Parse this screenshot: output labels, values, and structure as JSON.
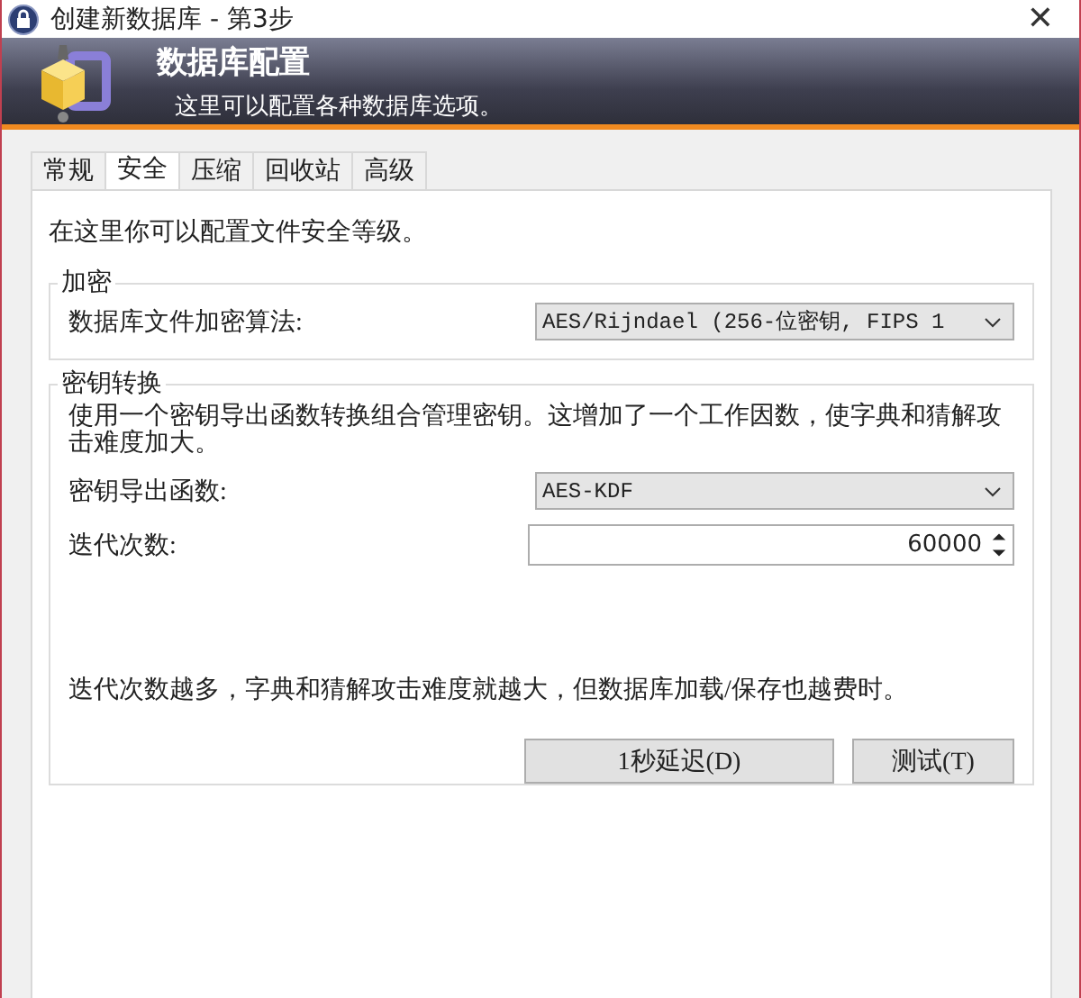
{
  "window": {
    "title": "创建新数据库 - 第3步",
    "close": "✕"
  },
  "banner": {
    "title": "数据库配置",
    "subtitle": "这里可以配置各种数据库选项。"
  },
  "tabs": [
    {
      "label": "常规",
      "selected": false
    },
    {
      "label": "安全",
      "selected": true
    },
    {
      "label": "压缩",
      "selected": false
    },
    {
      "label": "回收站",
      "selected": false
    },
    {
      "label": "高级",
      "selected": false
    }
  ],
  "intro": "在这里你可以配置文件安全等级。",
  "encryption": {
    "title": "加密",
    "label": "数据库文件加密算法:",
    "value": "AES/Rijndael (256-位密钥, FIPS 1"
  },
  "key_transform": {
    "title": "密钥转换",
    "description": "使用一个密钥导出函数转换组合管理密钥。这增加了一个工作因数，使字典和猜解攻击难度加大。",
    "kdf_label": "密钥导出函数:",
    "kdf_value": "AES-KDF",
    "iterations_label": "迭代次数:",
    "iterations_value": "60000",
    "note": "迭代次数越多，字典和猜解攻击难度就越大，但数据库加载/保存也越费时。",
    "buttons": [
      "1秒延迟(D)",
      "测试(T)"
    ]
  }
}
